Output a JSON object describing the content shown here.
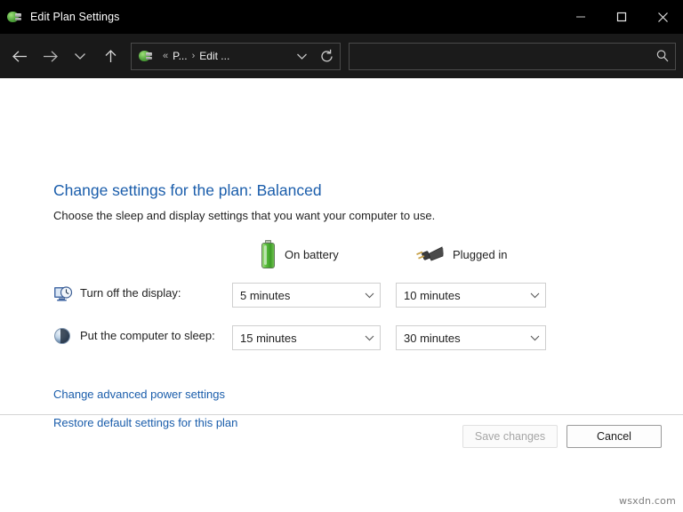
{
  "window": {
    "title": "Edit Plan Settings",
    "app_icon": "power-options-icon",
    "minimize_label": "Minimize",
    "maximize_label": "Maximize",
    "close_label": "Close"
  },
  "navbar": {
    "back_label": "Back",
    "forward_label": "Forward",
    "recent_label": "Recent locations",
    "up_label": "Up",
    "breadcrumb": {
      "icon": "power-options-icon",
      "overflow": "«",
      "items": [
        "P...",
        "Edit ..."
      ],
      "separator": "›"
    },
    "dropdown_label": "Previous locations",
    "refresh_label": "Refresh",
    "search": {
      "value": "",
      "placeholder": "",
      "icon": "search-icon"
    }
  },
  "page": {
    "title": "Change settings for the plan: Balanced",
    "subtitle": "Choose the sleep and display settings that you want your computer to use.",
    "columns": [
      {
        "label": "On battery",
        "icon": "battery-icon"
      },
      {
        "label": "Plugged in",
        "icon": "power-plug-icon"
      }
    ],
    "rows": [
      {
        "icon": "monitor-clock-icon",
        "label": "Turn off the display:",
        "on_battery": "5 minutes",
        "plugged_in": "10 minutes"
      },
      {
        "icon": "sleep-moon-icon",
        "label": "Put the computer to sleep:",
        "on_battery": "15 minutes",
        "plugged_in": "30 minutes"
      }
    ],
    "links": [
      "Change advanced power settings",
      "Restore default settings for this plan"
    ],
    "buttons": {
      "save": "Save changes",
      "save_enabled": false,
      "cancel": "Cancel",
      "cancel_enabled": true
    }
  },
  "watermark": "wsxdn.com",
  "colors": {
    "titlebar_bg": "#000000",
    "navbar_bg": "#191919",
    "content_bg": "#ffffff",
    "link": "#1a5dab",
    "heading": "#1a5dab",
    "battery_green": "#4ea23a"
  }
}
